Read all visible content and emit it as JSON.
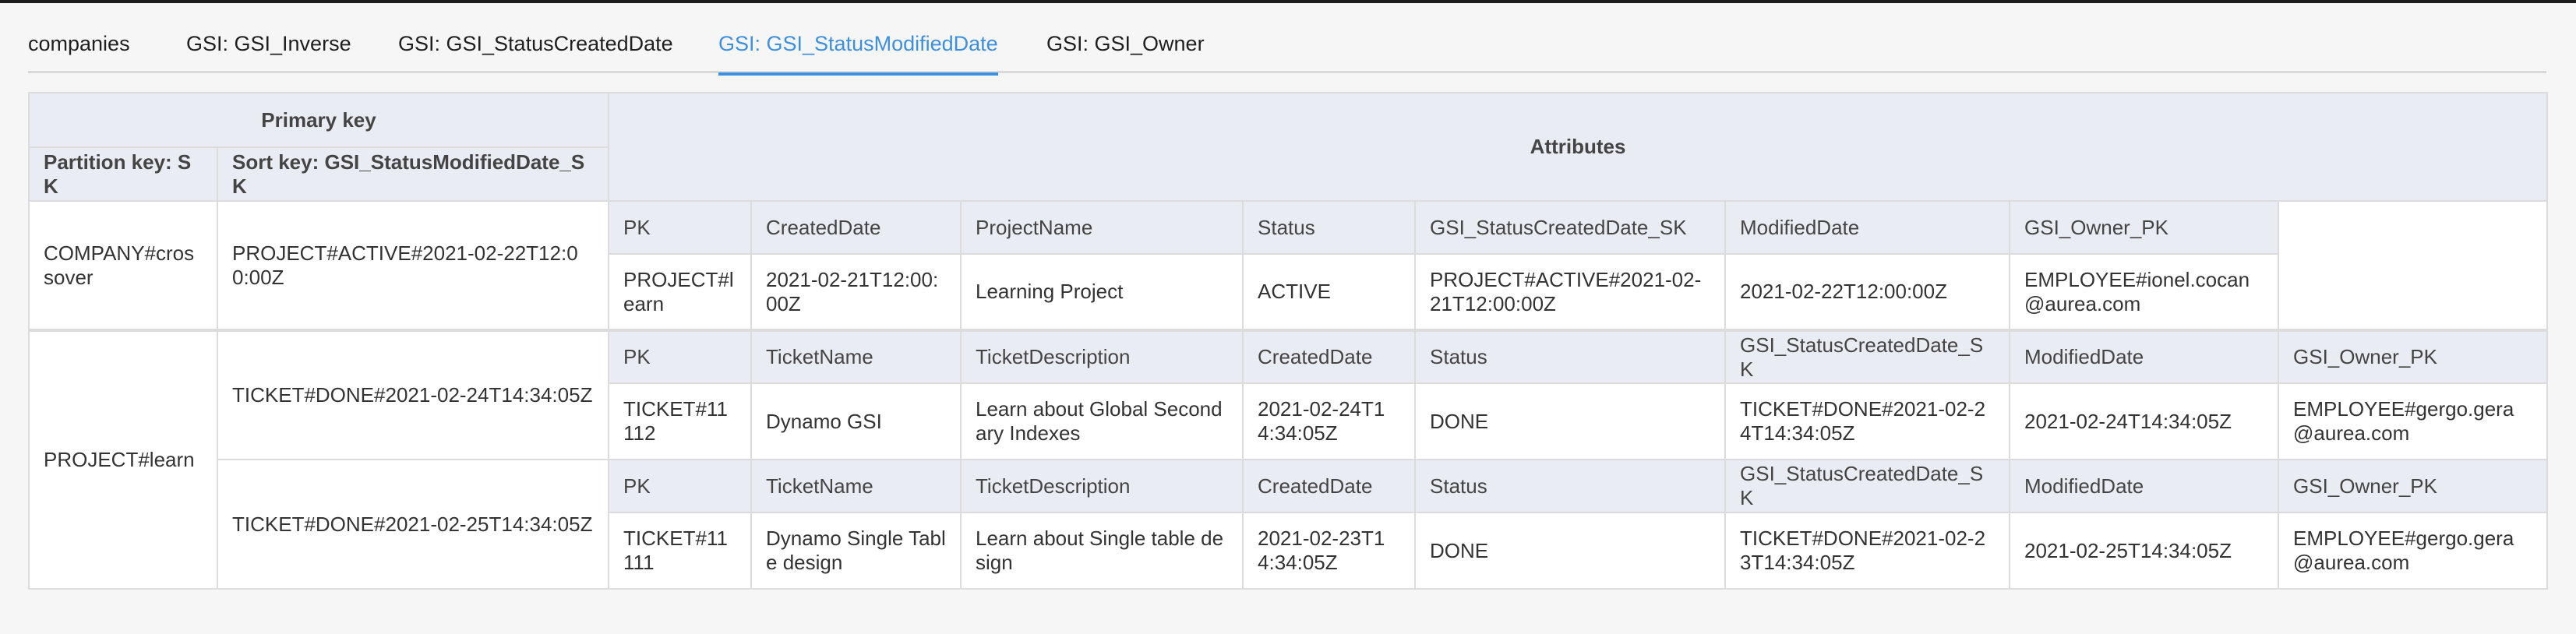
{
  "tabs": [
    {
      "label": "companies",
      "active": false
    },
    {
      "label": "GSI: GSI_Inverse",
      "active": false
    },
    {
      "label": "GSI: GSI_StatusCreatedDate",
      "active": false
    },
    {
      "label": "GSI: GSI_StatusModifiedDate",
      "active": true
    },
    {
      "label": "GSI: GSI_Owner",
      "active": false
    }
  ],
  "colors": {
    "accent": "#3d8fe0",
    "header_bg": "#e9edf3"
  },
  "table": {
    "primary_key_label": "Primary key",
    "attributes_label": "Attributes",
    "partition_key_label": "Partition key: SK",
    "sort_key_label": "Sort key: GSI_StatusModifiedDate_SK",
    "groups": [
      {
        "partition": "COMPANY#crossover",
        "items": [
          {
            "sort": "PROJECT#ACTIVE#2021-02-22T12:00:00Z",
            "headers": [
              "PK",
              "CreatedDate",
              "ProjectName",
              "Status",
              "GSI_StatusCreatedDate_SK",
              "ModifiedDate",
              "GSI_Owner_PK"
            ],
            "values": [
              "PROJECT#learn",
              "2021-02-21T12:00:00Z",
              "Learning Project",
              "ACTIVE",
              "PROJECT#ACTIVE#2021-02-21T12:00:00Z",
              "2021-02-22T12:00:00Z",
              "EMPLOYEE#ionel.cocan@aurea.com"
            ]
          }
        ]
      },
      {
        "partition": "PROJECT#learn",
        "items": [
          {
            "sort": "TICKET#DONE#2021-02-24T14:34:05Z",
            "headers": [
              "PK",
              "TicketName",
              "TicketDescription",
              "CreatedDate",
              "Status",
              "GSI_StatusCreatedDate_SK",
              "ModifiedDate",
              "GSI_Owner_PK"
            ],
            "values": [
              "TICKET#11112",
              "Dynamo GSI",
              "Learn about Global Secondary Indexes",
              "2021-02-24T14:34:05Z",
              "DONE",
              "TICKET#DONE#2021-02-24T14:34:05Z",
              "2021-02-24T14:34:05Z",
              "EMPLOYEE#gergo.gera@aurea.com"
            ]
          },
          {
            "sort": "TICKET#DONE#2021-02-25T14:34:05Z",
            "headers": [
              "PK",
              "TicketName",
              "TicketDescription",
              "CreatedDate",
              "Status",
              "GSI_StatusCreatedDate_SK",
              "ModifiedDate",
              "GSI_Owner_PK"
            ],
            "values": [
              "TICKET#11111",
              "Dynamo Single Table design",
              "Learn about Single table design",
              "2021-02-23T14:34:05Z",
              "DONE",
              "TICKET#DONE#2021-02-23T14:34:05Z",
              "2021-02-25T14:34:05Z",
              "EMPLOYEE#gergo.gera@aurea.com"
            ]
          }
        ]
      }
    ]
  }
}
